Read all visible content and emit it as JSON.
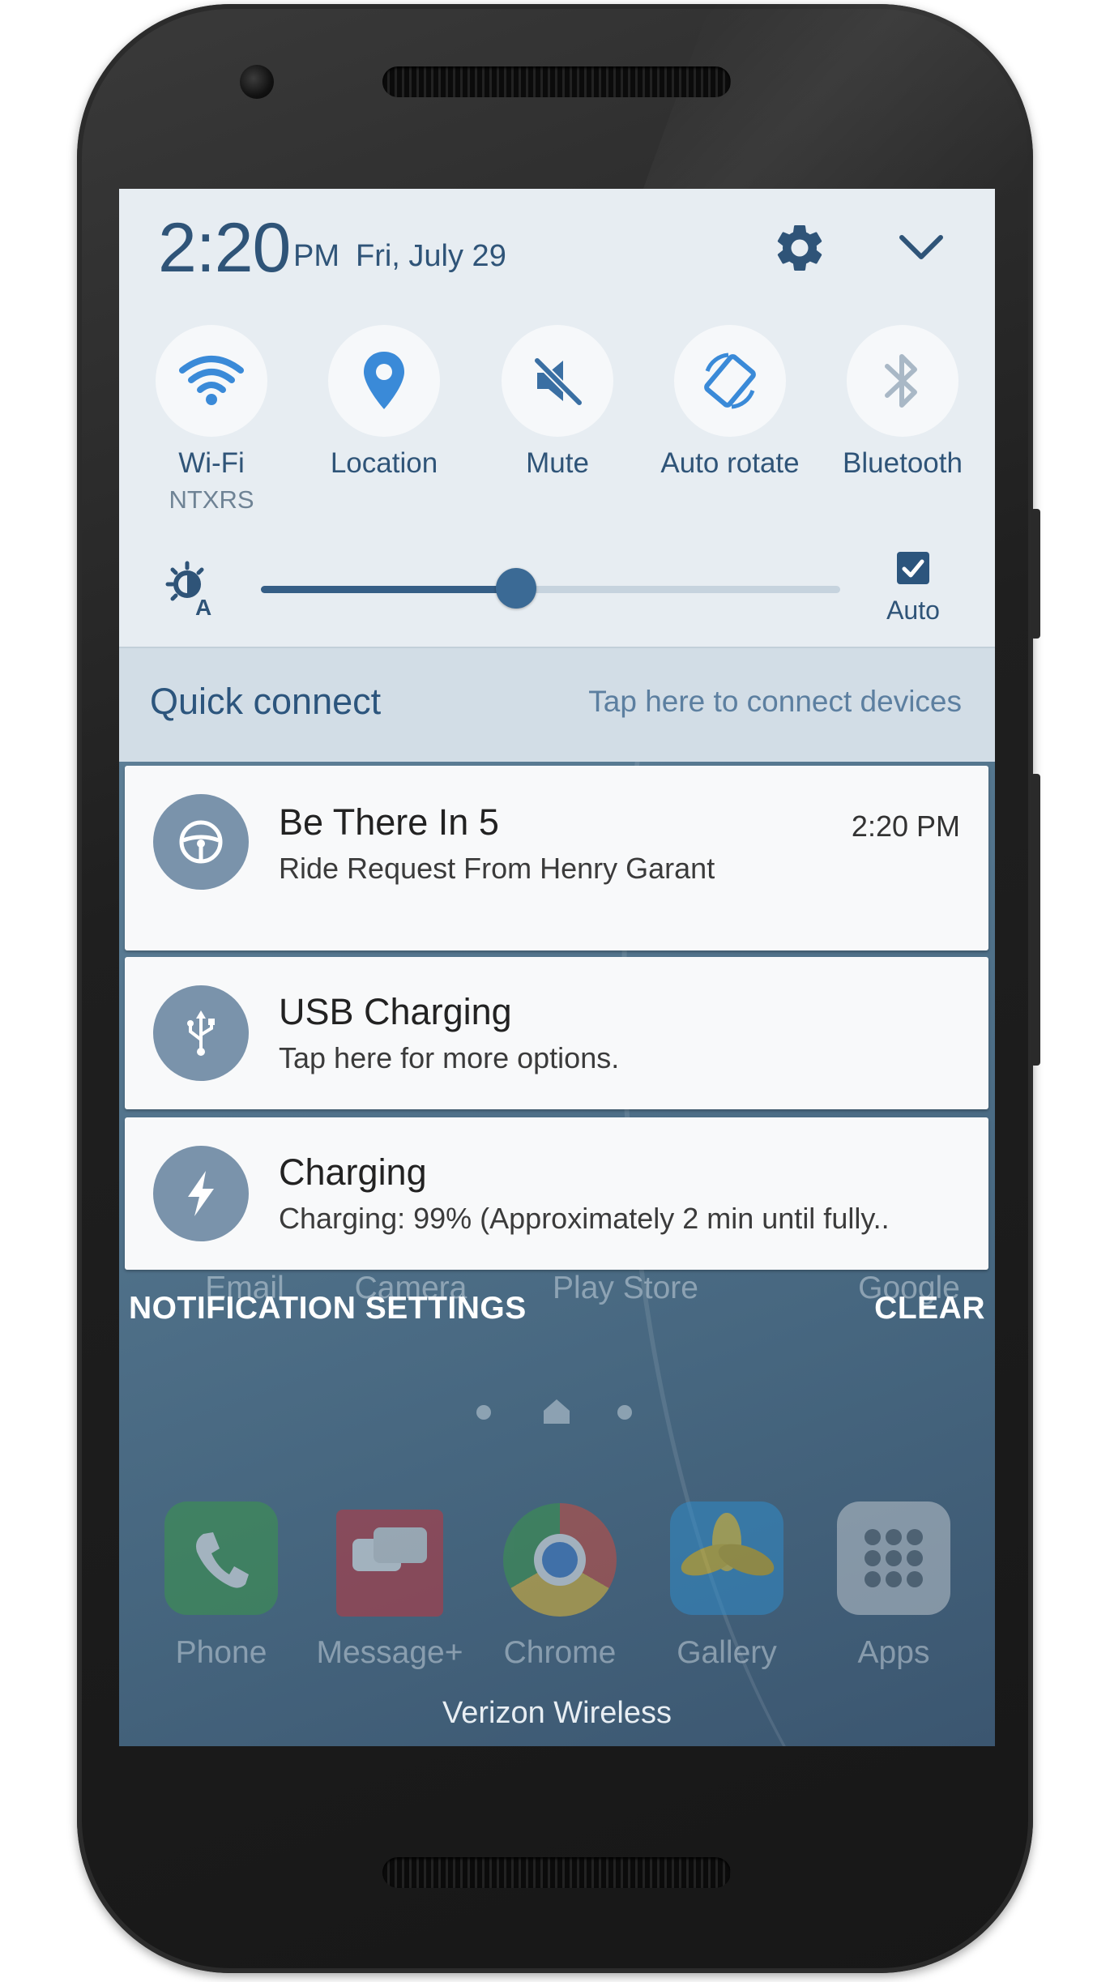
{
  "status_header": {
    "time": "2:20",
    "ampm": "PM",
    "date": "Fri, July 29",
    "settings_icon": "gear-icon",
    "collapse_icon": "chevron-down-icon"
  },
  "quick_settings": {
    "tiles": [
      {
        "label": "Wi-Fi",
        "sublabel": "NTXRS",
        "icon": "wifi-icon",
        "active": true
      },
      {
        "label": "Location",
        "sublabel": "",
        "icon": "location-pin-icon",
        "active": true
      },
      {
        "label": "Mute",
        "sublabel": "",
        "icon": "mute-icon",
        "active": true
      },
      {
        "label": "Auto rotate",
        "sublabel": "",
        "icon": "auto-rotate-icon",
        "active": true
      },
      {
        "label": "Bluetooth",
        "sublabel": "",
        "icon": "bluetooth-icon",
        "active": false
      }
    ],
    "brightness": {
      "icon": "auto-brightness-icon",
      "level": 0.44,
      "auto_label": "Auto",
      "auto_checked": true
    }
  },
  "quick_connect": {
    "title": "Quick connect",
    "hint": "Tap here to connect devices"
  },
  "notifications": [
    {
      "title": "Be There In 5",
      "body": "Ride Request From Henry Garant",
      "time": "2:20 PM",
      "icon": "steering-wheel-icon"
    },
    {
      "title": "USB Charging",
      "body": "Tap here for more options.",
      "time": "",
      "icon": "usb-icon"
    },
    {
      "title": "Charging",
      "body": "Charging: 99% (Approximately 2 min until fully..",
      "time": "",
      "icon": "lightning-bolt-icon"
    }
  ],
  "footer": {
    "settings_label": "NOTIFICATION SETTINGS",
    "clear_label": "CLEAR"
  },
  "home_screen": {
    "faded_row": [
      "Email",
      "Camera",
      "Play Store",
      "Google"
    ],
    "dock": [
      {
        "label": "Phone",
        "icon": "phone-icon",
        "color": "#3a9b46"
      },
      {
        "label": "Message+",
        "icon": "message-icon",
        "color": "#c8323a"
      },
      {
        "label": "Chrome",
        "icon": "chrome-icon",
        "color": "#d64a3a"
      },
      {
        "label": "Gallery",
        "icon": "gallery-icon",
        "color": "#2f8fd0"
      },
      {
        "label": "Apps",
        "icon": "apps-grid-icon",
        "color": "#c9d0d6"
      }
    ],
    "carrier": "Verizon Wireless"
  }
}
